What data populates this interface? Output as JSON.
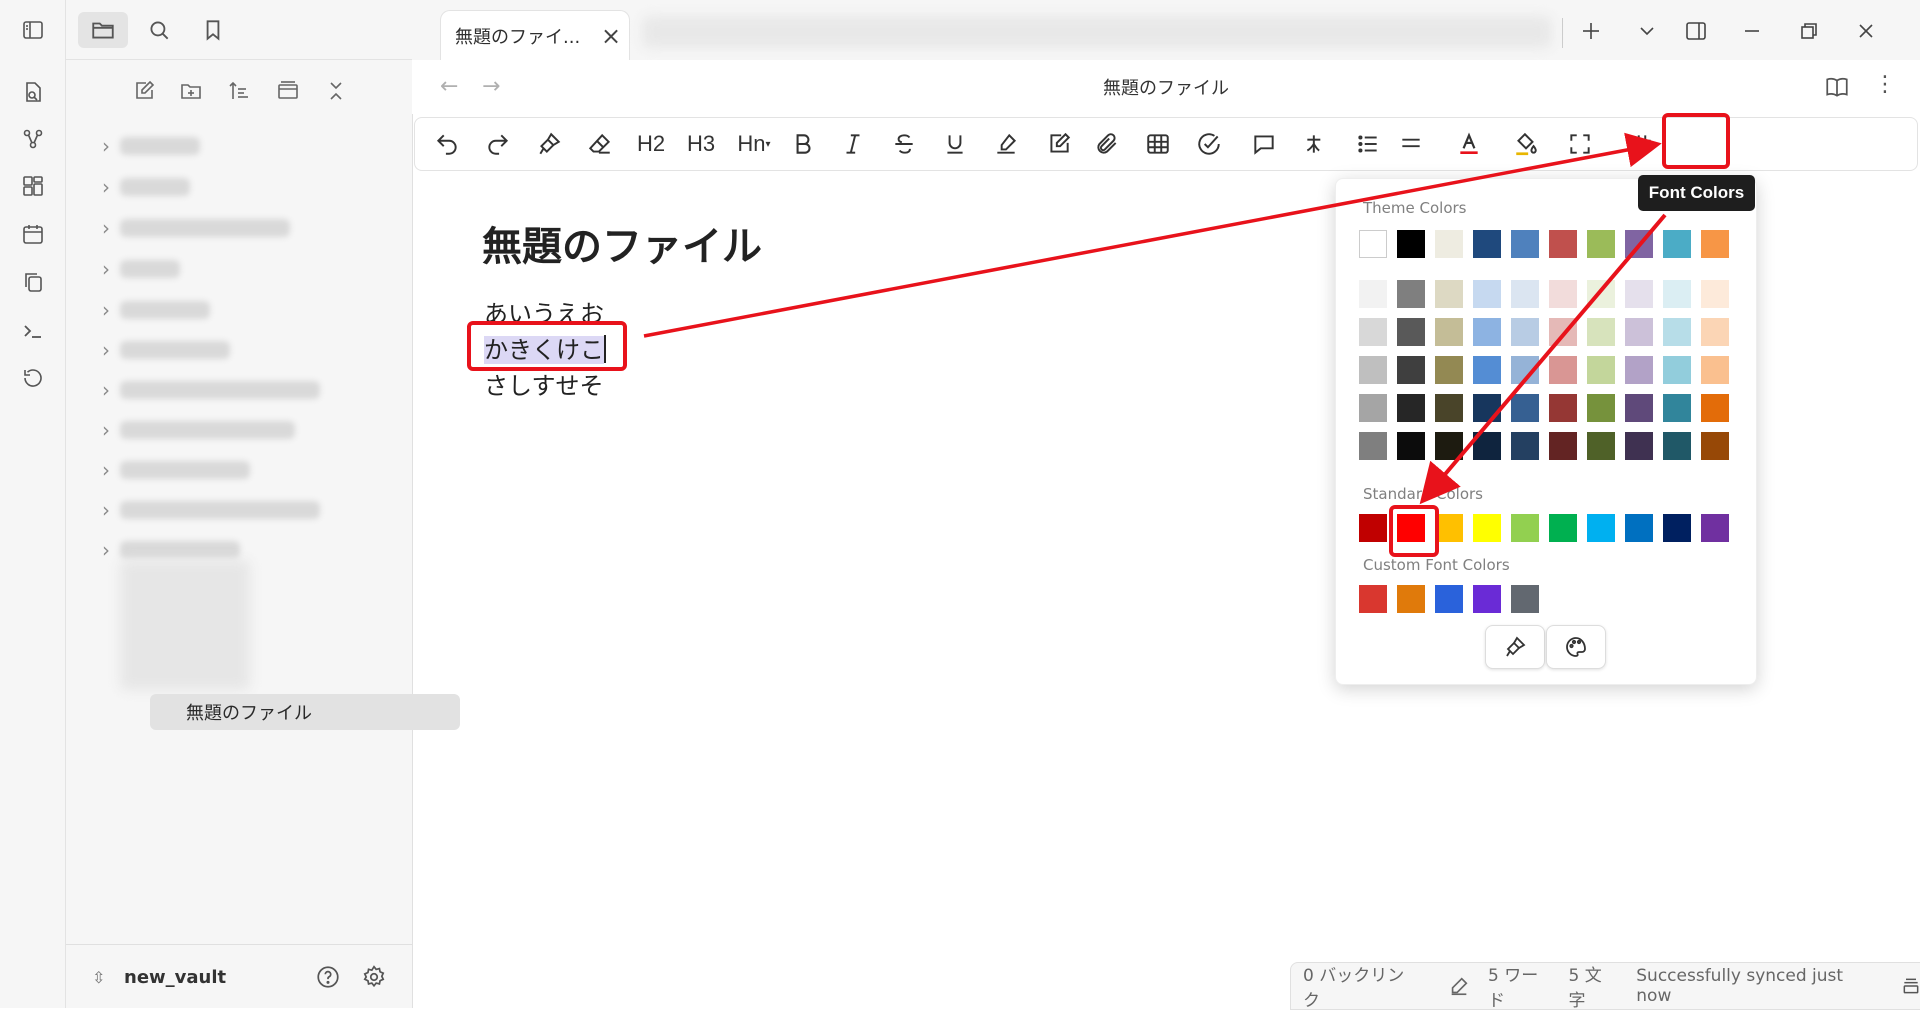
{
  "tab": {
    "title": "無題のファイ...",
    "close": "×"
  },
  "header": {
    "title": "無題のファイル"
  },
  "toolbar": {
    "h2": "H2",
    "h3": "H3",
    "hn": "Hn",
    "font_colors_tooltip": "Font Colors"
  },
  "document": {
    "title": "無題のファイル",
    "lines": [
      "あいうえお",
      "かきくけこ",
      "さしすせそ"
    ]
  },
  "sidebar": {
    "active_file": "無題のファイル",
    "vault_name": "new_vault"
  },
  "color_popup": {
    "theme_label": "Theme Colors",
    "standard_label": "Standard Colors",
    "custom_label": "Custom Font Colors",
    "theme_top": [
      "#ffffff",
      "#000000",
      "#eeece1",
      "#1f497d",
      "#4f81bd",
      "#c0504d",
      "#9bbb59",
      "#8064a2",
      "#4bacc6",
      "#f79646"
    ],
    "theme_shades": [
      [
        "#f2f2f2",
        "#7f7f7f",
        "#ddd9c3",
        "#c6d9f0",
        "#dbe5f1",
        "#f2dcdb",
        "#ebf1dd",
        "#e5e0ec",
        "#dbeef3",
        "#fdeada"
      ],
      [
        "#d8d8d8",
        "#595959",
        "#c4bd97",
        "#8db3e2",
        "#b8cce4",
        "#e5b9b7",
        "#d7e3bc",
        "#ccc1d9",
        "#b7dde8",
        "#fbd5b5"
      ],
      [
        "#bfbfbf",
        "#3f3f3f",
        "#938953",
        "#548dd4",
        "#95b3d7",
        "#d99694",
        "#c3d69b",
        "#b2a2c7",
        "#92cddc",
        "#fac08f"
      ],
      [
        "#a5a5a5",
        "#262626",
        "#494429",
        "#17365d",
        "#366092",
        "#953734",
        "#76923c",
        "#5f497a",
        "#31859b",
        "#e36c09"
      ],
      [
        "#7f7f7f",
        "#0c0c0c",
        "#1d1b10",
        "#0f243e",
        "#244061",
        "#632423",
        "#4f6128",
        "#3f3151",
        "#205867",
        "#974806"
      ]
    ],
    "standard": [
      "#c00000",
      "#ff0000",
      "#ffc000",
      "#ffff00",
      "#92d050",
      "#00b050",
      "#00b0f0",
      "#0070c0",
      "#002060",
      "#7030a0"
    ],
    "custom": [
      "#d9372f",
      "#e07a0b",
      "#2a62db",
      "#6a2bd6",
      "#626870"
    ]
  },
  "status": {
    "backlinks": "0 バックリンク",
    "words": "5 ワード",
    "chars": "5 文字",
    "sync": "Successfully synced just now"
  },
  "annotation_color": "#e8121b"
}
